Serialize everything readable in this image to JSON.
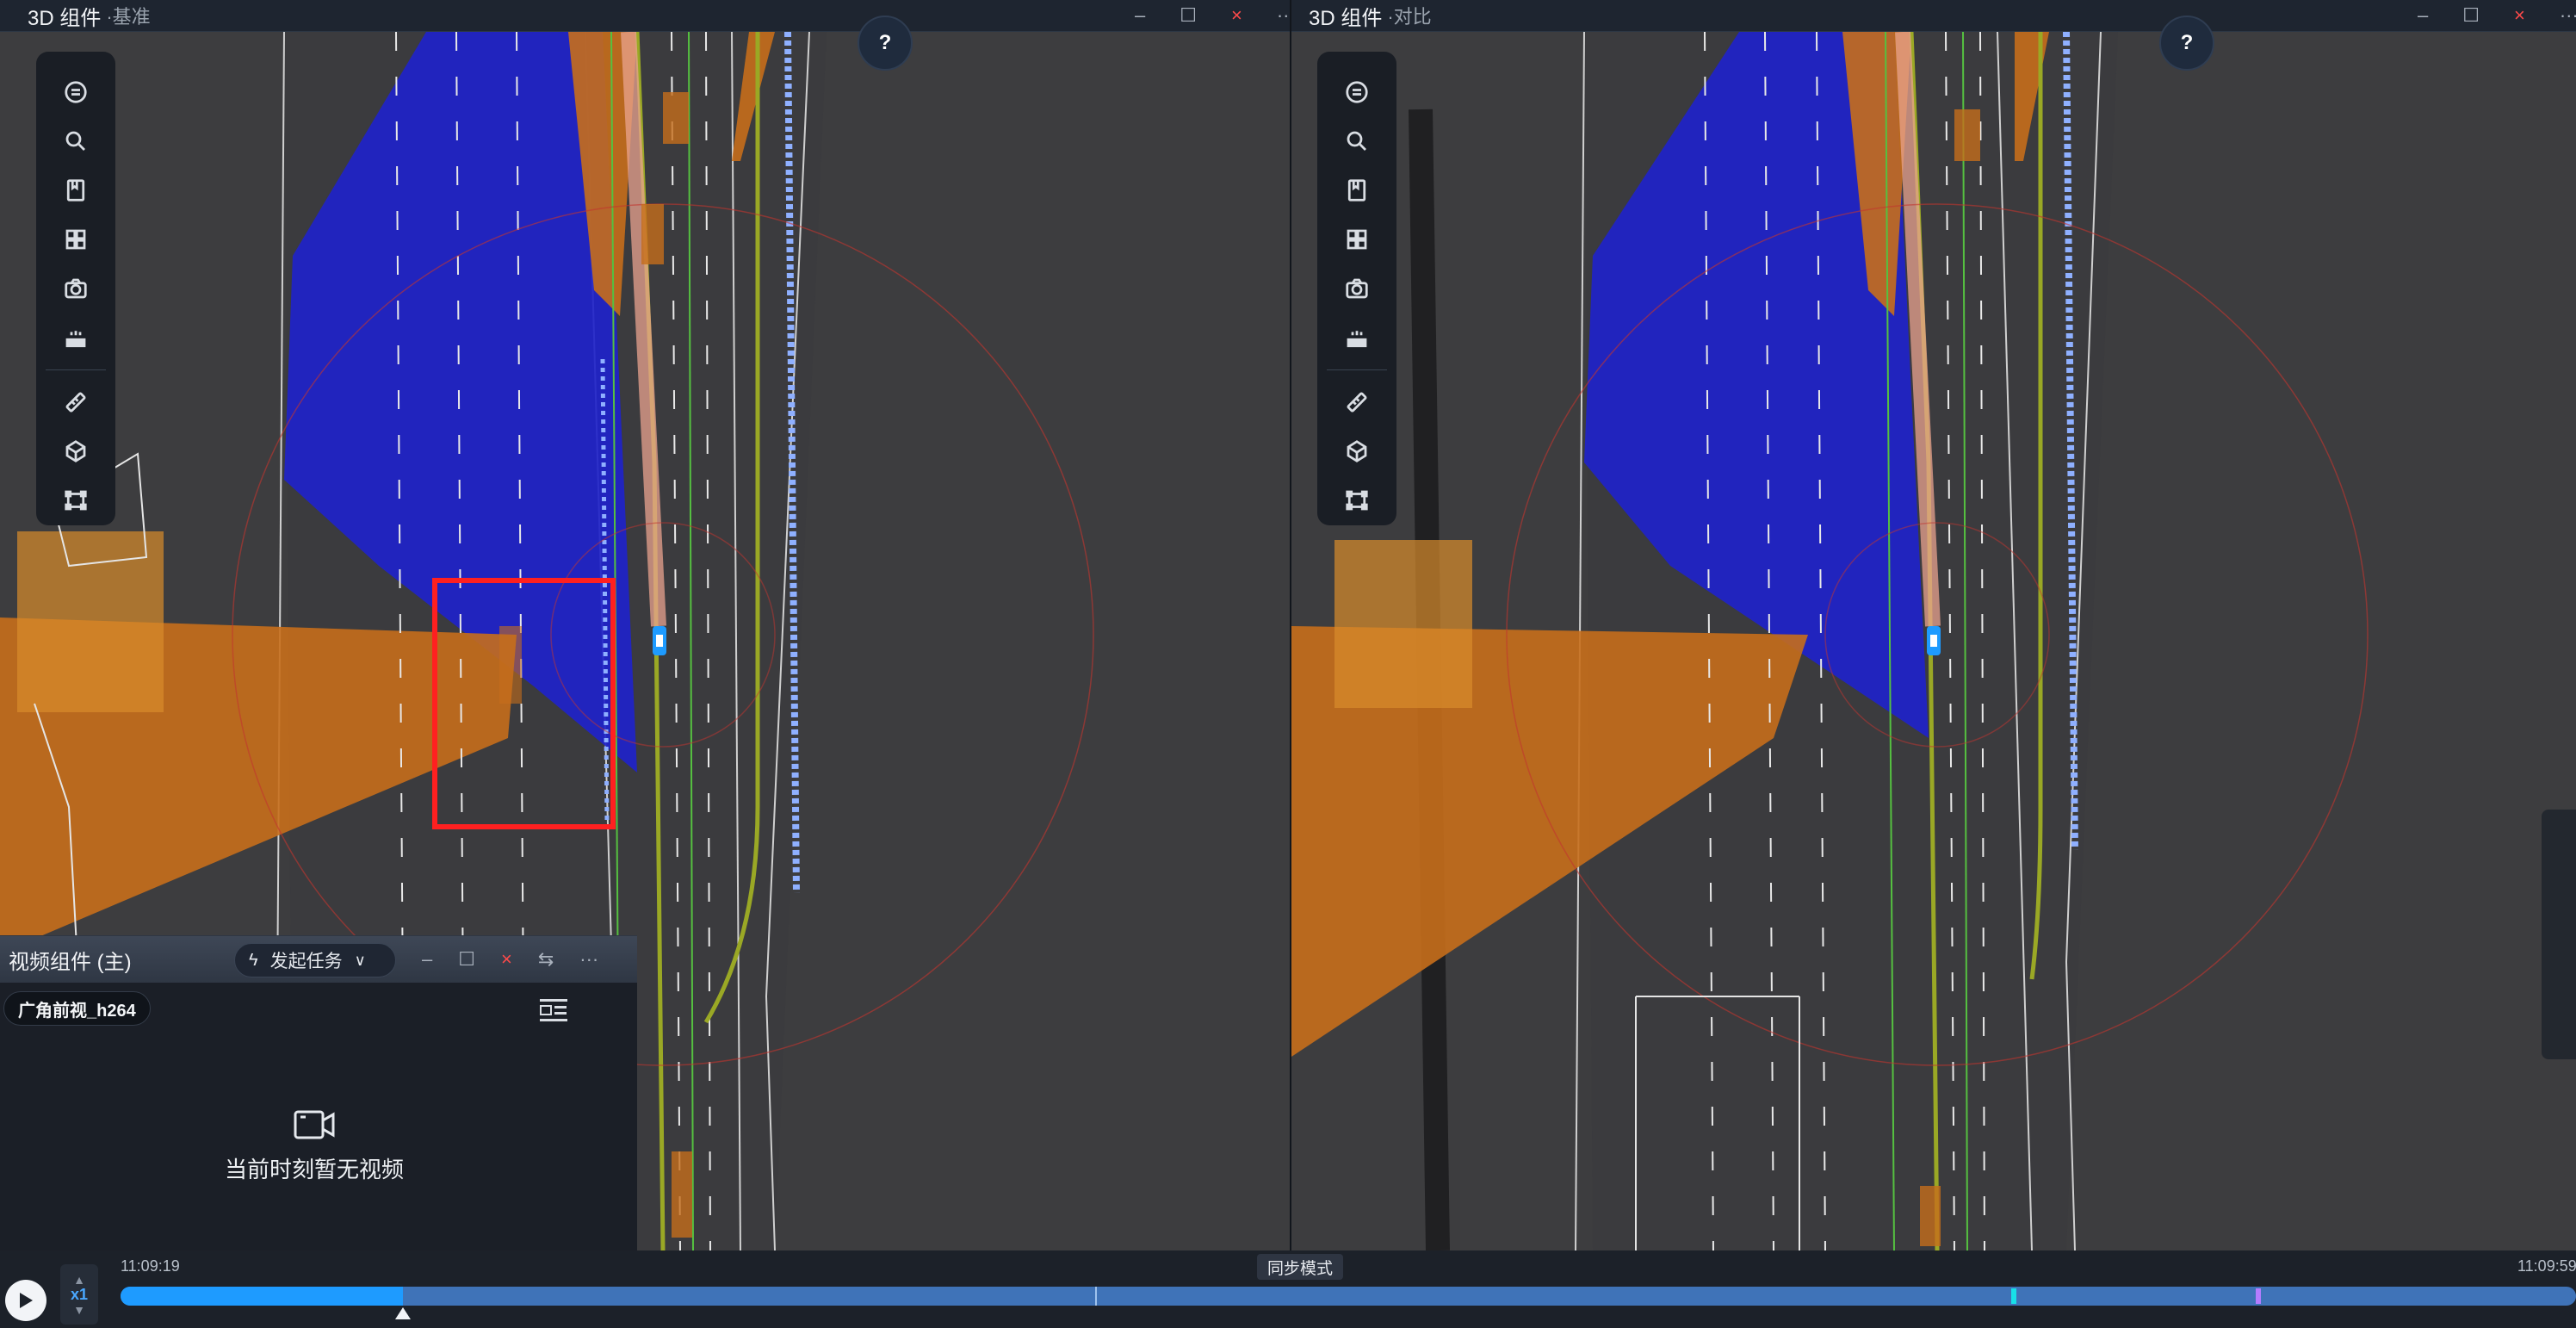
{
  "left_panel": {
    "title": "3D 组件",
    "subtitle": "·基准",
    "help_label": "?",
    "window_controls": {
      "minimize": "–",
      "maximize": "☐",
      "close": "×",
      "more": "···"
    }
  },
  "right_panel": {
    "title": "3D 组件",
    "subtitle": "·对比",
    "help_label": "?",
    "window_controls": {
      "minimize": "–",
      "maximize": "☐",
      "close": "×",
      "more": "···"
    }
  },
  "toolbar_icons": [
    "menu-icon",
    "search-icon",
    "bookmark-icon",
    "grid-icon",
    "camera-icon",
    "weather-icon",
    "ruler-icon",
    "cube-icon",
    "bounding-box-icon"
  ],
  "video_component": {
    "title": "视频组件 (主)",
    "task_button": "发起任务",
    "camera_chip": "广角前视_h264",
    "no_video_message": "当前时刻暂无视频",
    "window_controls": {
      "minimize": "–",
      "maximize": "☐",
      "close": "×",
      "swap": "⇆",
      "more": "···"
    }
  },
  "timeline": {
    "start_time": "11:09:19",
    "end_time": "11:09:59",
    "sync_mode_label": "同步模式",
    "speed_label": "x1",
    "progress_fraction": 0.115
  },
  "colors": {
    "accent_blue": "#1e9bff",
    "close_red": "#ff4a4a",
    "lidar_blue": "#1f23c9",
    "zone_orange": "#c66e1b",
    "highlight_red": "#ff2020"
  }
}
